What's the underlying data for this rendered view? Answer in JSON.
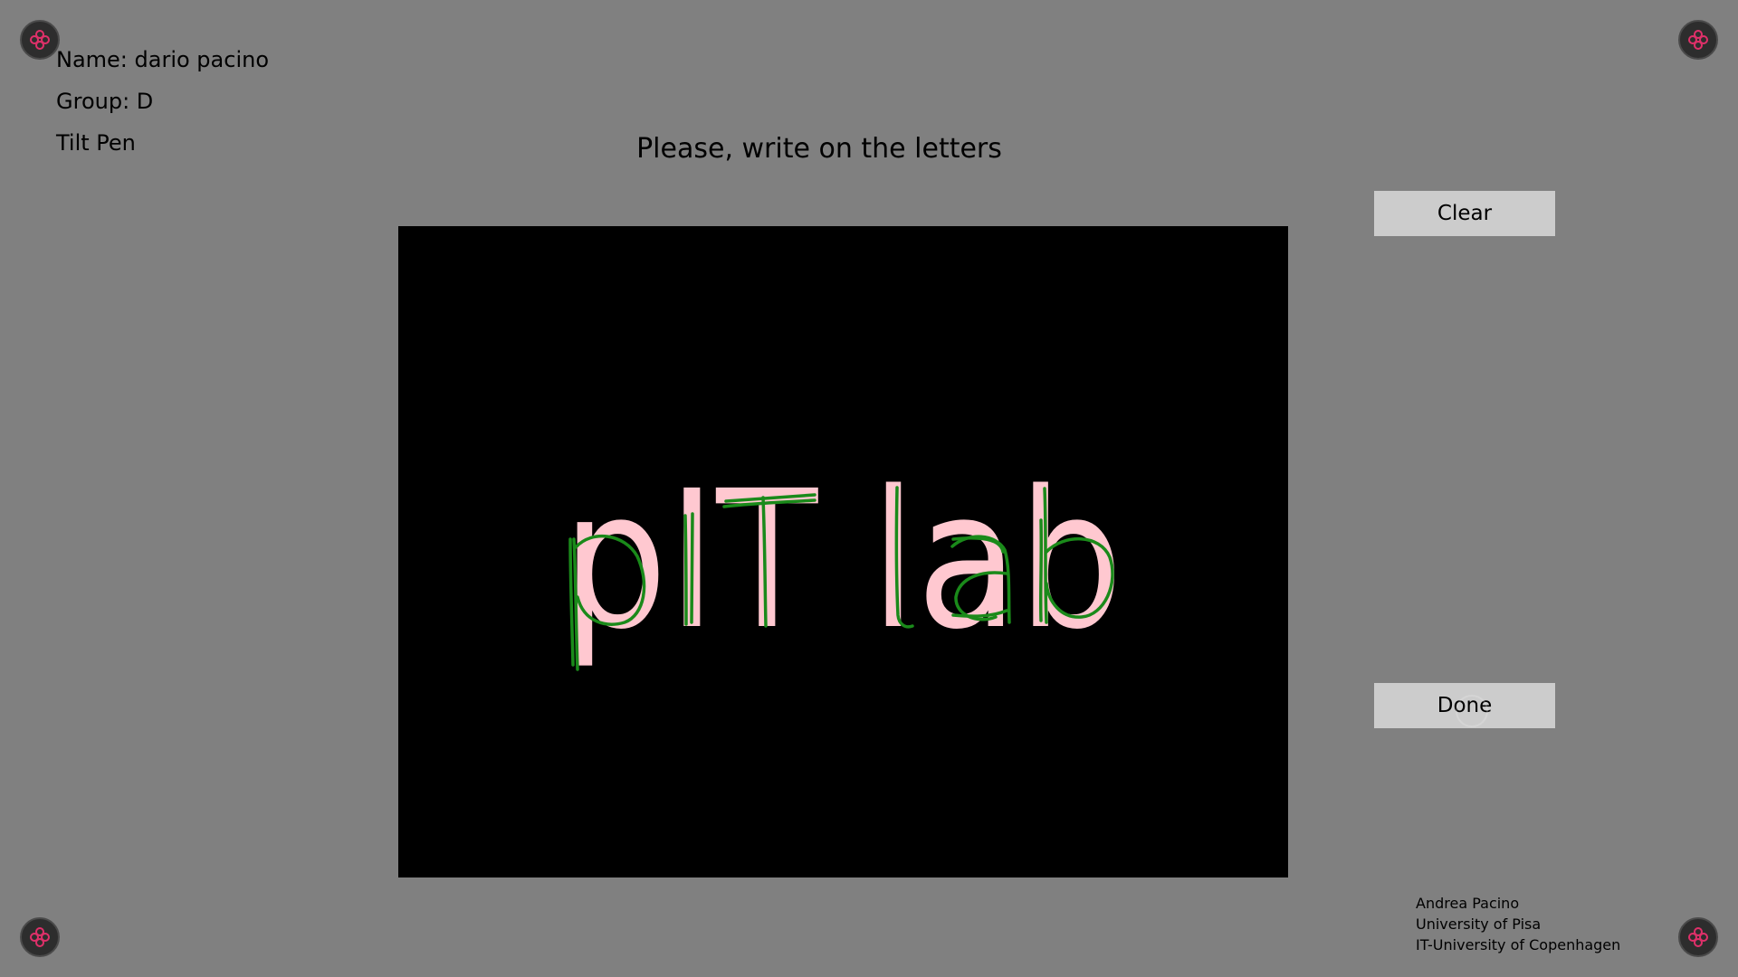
{
  "participant": {
    "name": "Name: dario pacino",
    "group": "Group: D",
    "condition": "Tilt Pen"
  },
  "instruction": "Please, write on the letters",
  "buttons": {
    "clear_label": "Clear",
    "done_label": "Done"
  },
  "canvas": {
    "target_text": "pIT lab",
    "background_color": "#000000",
    "letter_color": "#ffc8d0",
    "stroke_color": "#1a8a1a"
  },
  "corner_icon": "flower-target-icon",
  "credits": {
    "line1": "Andrea Pacino",
    "line2": "University of Pisa",
    "line3": "IT-University of Copenhagen"
  },
  "colors": {
    "background": "#808080",
    "button": "#cccccc",
    "corner_accent": "#e0306a"
  }
}
